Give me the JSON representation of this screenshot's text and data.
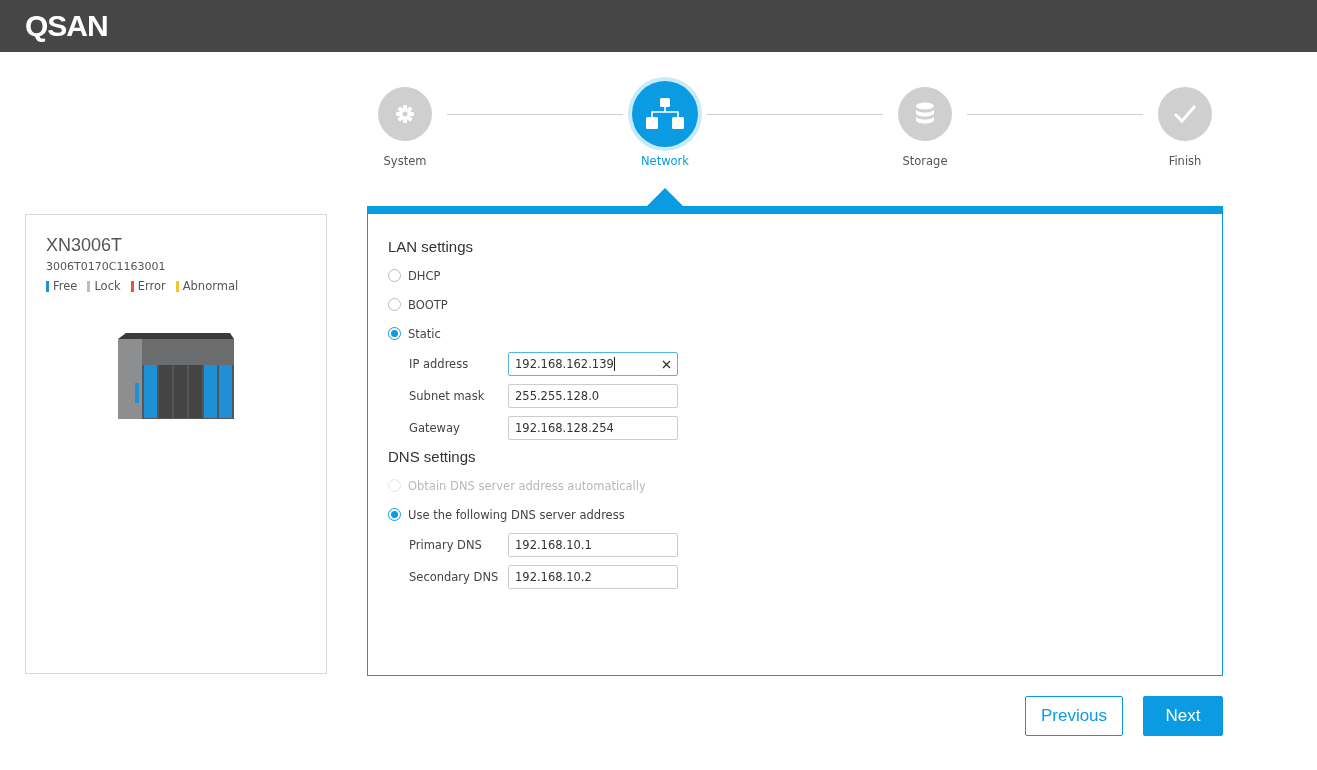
{
  "header": {
    "logo": "QSAN"
  },
  "steps": [
    {
      "label": "System",
      "selected": false
    },
    {
      "label": "Network",
      "selected": true
    },
    {
      "label": "Storage",
      "selected": false
    },
    {
      "label": "Finish",
      "selected": false
    }
  ],
  "device": {
    "model": "XN3006T",
    "serial": "3006T0170C1163001",
    "legend": [
      {
        "label": "Free",
        "color": "#1e90d6"
      },
      {
        "label": "Lock",
        "color": "#bdbdbd"
      },
      {
        "label": "Error",
        "color": "#e8553a"
      },
      {
        "label": "Abnormal",
        "color": "#f2c430"
      }
    ],
    "bays": [
      {
        "color": "#1e90d6"
      },
      {
        "color": "#444444"
      },
      {
        "color": "#444444"
      },
      {
        "color": "#444444"
      },
      {
        "color": "#1e90d6"
      },
      {
        "color": "#1e90d6"
      }
    ]
  },
  "lan": {
    "title": "LAN settings",
    "options": [
      {
        "label": "DHCP",
        "selected": false,
        "disabled": false
      },
      {
        "label": "BOOTP",
        "selected": false,
        "disabled": false
      },
      {
        "label": "Static",
        "selected": true,
        "disabled": false
      }
    ],
    "fields": [
      {
        "label": "IP address",
        "value": "192.168.162.139",
        "focused": true
      },
      {
        "label": "Subnet mask",
        "value": "255.255.128.0",
        "focused": false
      },
      {
        "label": "Gateway",
        "value": "192.168.128.254",
        "focused": false
      }
    ]
  },
  "dns": {
    "title": "DNS settings",
    "options": [
      {
        "label": "Obtain DNS server address automatically",
        "selected": false,
        "disabled": true
      },
      {
        "label": "Use the following DNS server address",
        "selected": true,
        "disabled": false
      }
    ],
    "fields": [
      {
        "label": "Primary DNS",
        "value": "192.168.10.1",
        "focused": false
      },
      {
        "label": "Secondary DNS",
        "value": "192.168.10.2",
        "focused": false
      }
    ]
  },
  "buttons": [
    {
      "label": "Previous",
      "kind": "secondary"
    },
    {
      "label": "Next",
      "kind": "primary"
    }
  ]
}
